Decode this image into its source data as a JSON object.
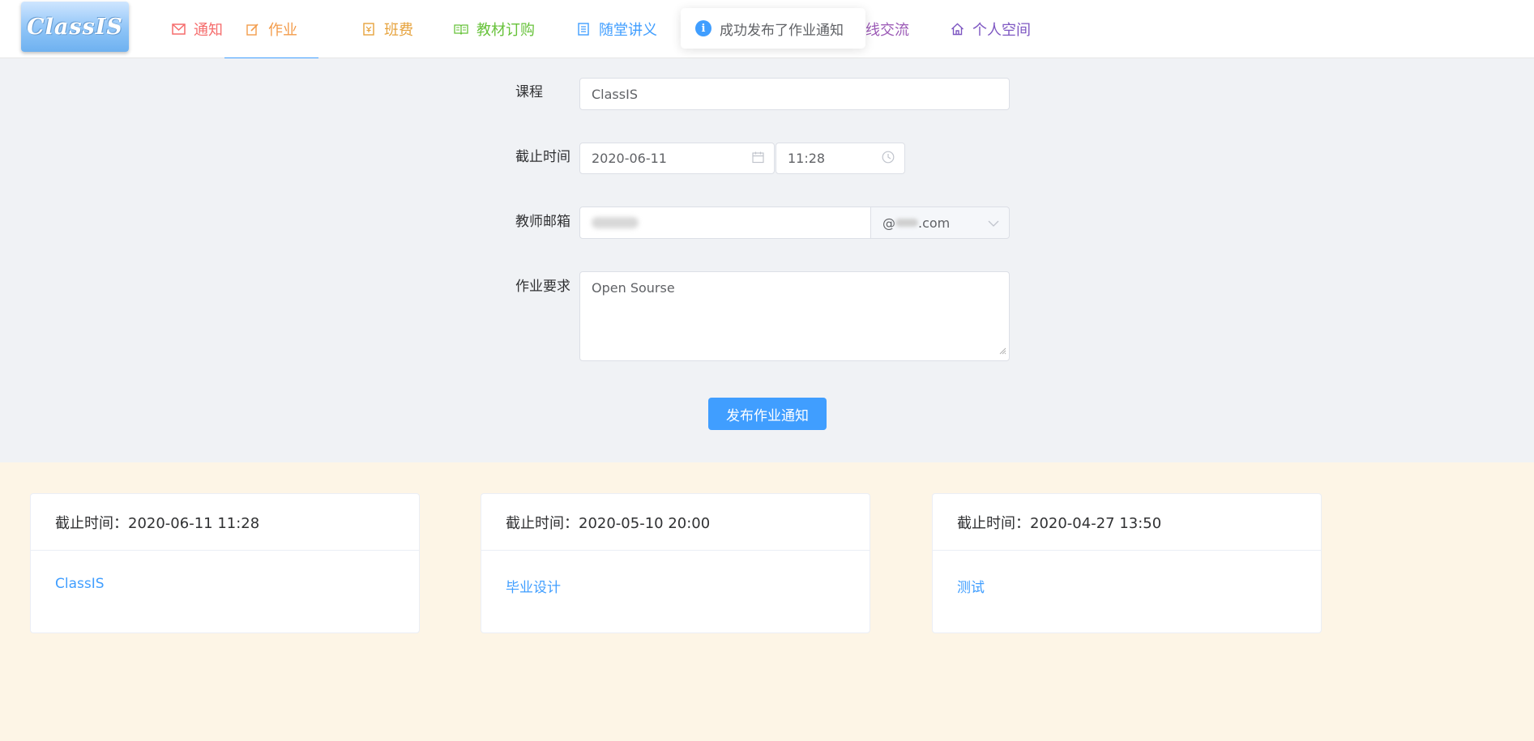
{
  "app": {
    "logo_text": "ClassIS"
  },
  "nav": [
    {
      "label": "通知",
      "color": "#f56c6c",
      "icon": "mail-icon"
    },
    {
      "label": "作业",
      "color": "#f39c4b",
      "icon": "edit-icon",
      "active": true
    },
    {
      "label": "班费",
      "color": "#e6a23c",
      "icon": "receipt-icon"
    },
    {
      "label": "教材订购",
      "color": "#67c23a",
      "icon": "book-icon"
    },
    {
      "label": "随堂讲义",
      "color": "#409eff",
      "icon": "document-icon"
    },
    {
      "label": "线交流",
      "color": "#9b59b6",
      "icon": "chat-icon"
    },
    {
      "label": "个人空间",
      "color": "#7e57c2",
      "icon": "home-icon"
    }
  ],
  "toast": {
    "message": "成功发布了作业通知",
    "icon": "info-icon"
  },
  "form": {
    "course_label": "课程",
    "course_value": "ClassIS",
    "deadline_label": "截止时间",
    "date_value": "2020-06-11",
    "time_value": "11:28",
    "email_label": "教师邮箱",
    "email_domain_prefix": "@",
    "email_domain_suffix": ".com",
    "requirement_label": "作业要求",
    "requirement_value": "Open Sourse",
    "submit_label": "发布作业通知"
  },
  "cards": [
    {
      "deadline": "截止时间：2020-06-11 11:28",
      "title": "ClassIS"
    },
    {
      "deadline": "截止时间：2020-05-10 20:00",
      "title": "毕业设计"
    },
    {
      "deadline": "截止时间：2020-04-27 13:50",
      "title": "测试"
    }
  ],
  "colors": {
    "accent": "#409eff",
    "form_bg": "#f0f2f5",
    "cards_bg": "#fdf5e6"
  }
}
